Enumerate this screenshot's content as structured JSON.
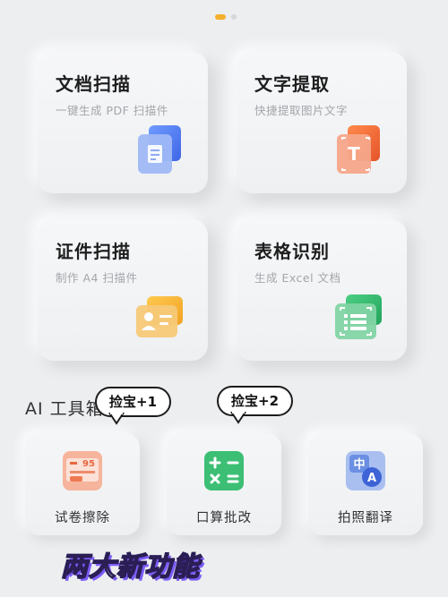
{
  "feature_cards": [
    {
      "title": "文档扫描",
      "subtitle": "一键生成 PDF 扫描件",
      "icon": "document-scan-icon"
    },
    {
      "title": "文字提取",
      "subtitle": "快捷提取图片文字",
      "icon": "text-extract-icon"
    },
    {
      "title": "证件扫描",
      "subtitle": "制作 A4 扫描件",
      "icon": "id-card-scan-icon"
    },
    {
      "title": "表格识别",
      "subtitle": "生成 Excel 文档",
      "icon": "table-recognition-icon"
    }
  ],
  "ai_tools": {
    "section_title": "AI 工具箱",
    "items": [
      {
        "label": "试卷擦除",
        "icon": "exam-erase-icon"
      },
      {
        "label": "口算批改",
        "icon": "math-check-icon"
      },
      {
        "label": "拍照翻译",
        "icon": "photo-translate-icon"
      }
    ]
  },
  "bubbles": {
    "left": "捡宝+1",
    "right": "捡宝+2"
  },
  "caption": "两大新功能",
  "icon_text": {
    "exam_score": "95",
    "translate_source": "中",
    "translate_target": "A",
    "text_extract": "T"
  },
  "colors": {
    "accent_yellow": "#f3b02a",
    "doc_blue": "#5b86f0",
    "text_orange": "#f26a3a",
    "id_yellow": "#f4b43a",
    "table_green": "#35b26a",
    "caption_purple": "#7c5cf6"
  }
}
